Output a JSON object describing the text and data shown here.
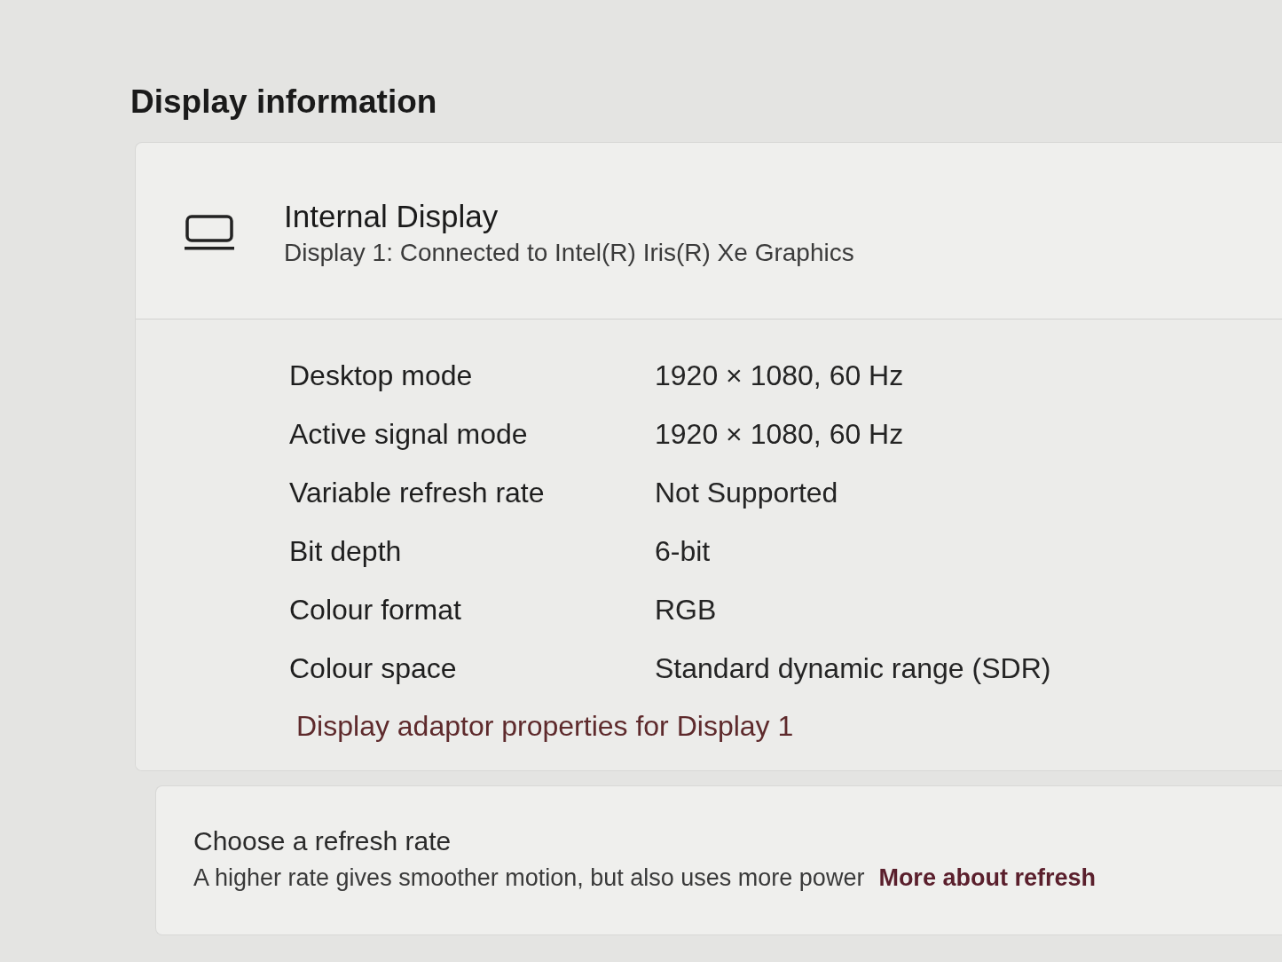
{
  "section_title": "Display information",
  "display_card": {
    "title": "Internal Display",
    "subtitle": "Display 1: Connected to Intel(R) Iris(R) Xe Graphics",
    "properties": [
      {
        "label": "Desktop mode",
        "value": "1920 × 1080, 60 Hz"
      },
      {
        "label": "Active signal mode",
        "value": "1920 × 1080, 60 Hz"
      },
      {
        "label": "Variable refresh rate",
        "value": "Not Supported"
      },
      {
        "label": "Bit depth",
        "value": "6-bit"
      },
      {
        "label": "Colour format",
        "value": "RGB"
      },
      {
        "label": "Colour space",
        "value": "Standard dynamic range (SDR)"
      }
    ],
    "adapter_link": "Display adaptor properties for Display 1"
  },
  "refresh_card": {
    "title": "Choose a refresh rate",
    "description": "A higher rate gives smoother motion, but also uses more power",
    "link": "More about refresh"
  }
}
